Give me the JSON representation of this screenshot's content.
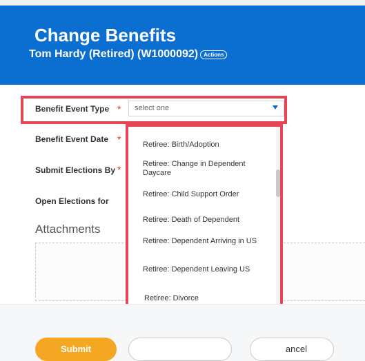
{
  "header": {
    "title": "Change Benefits",
    "employee": "Tom Hardy (Retired) (W1000092)",
    "actions_label": "Actions"
  },
  "form": {
    "fields": [
      {
        "label": "Benefit Event Type",
        "required": true
      },
      {
        "label": "Benefit Event Date",
        "required": true
      },
      {
        "label": "Submit Elections By",
        "required": true
      },
      {
        "label": "Open Elections for",
        "required": false
      }
    ],
    "required_marker": "*",
    "select_value": "select one",
    "options": [
      "Retiree: Birth/Adoption",
      "Retiree: Change in Dependent Daycare",
      "Retiree: Child Support Order",
      "Retiree: Death of Dependent",
      "Retiree: Dependent Arriving in US",
      "Retiree: Dependent Leaving US",
      "Retiree: Divorce"
    ],
    "attachments_label": "Attachments"
  },
  "footer": {
    "submit_label": "Submit",
    "cancel_label": "ancel"
  },
  "colors": {
    "header_blue": "#0b6fd1",
    "submit_orange": "#f5a623",
    "highlight_red": "#e64556",
    "required_red": "#e4302e"
  }
}
